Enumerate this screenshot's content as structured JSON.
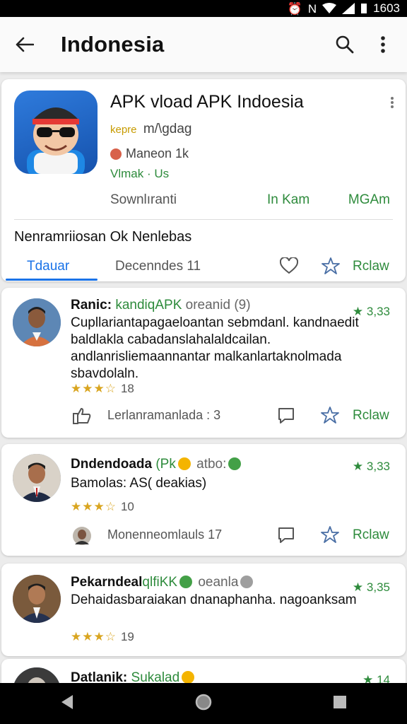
{
  "status_bar": {
    "time": "1603",
    "alarm_icon": "alarm-icon",
    "nfc_label": "N"
  },
  "app_bar": {
    "title": "Indonesia",
    "back_icon": "arrow-back-icon",
    "search_icon": "search-icon",
    "menu_icon": "more-vert-icon"
  },
  "app_card": {
    "name": "APK vload APK Indoesia",
    "badge": "kepre",
    "developer": "m/\\gdag",
    "maintainer": "Maneon 1k",
    "version": "Vlmak · Us",
    "meta": {
      "downloads": "Sownlıranti",
      "size": "In Kam",
      "rating": "MGAm"
    },
    "description": "Nenramriiosan Ok Nenlebas",
    "tab_active": "Tdauar",
    "tab_two": "Decenndes 11",
    "review_label": "Rclaw"
  },
  "reviews": [
    {
      "name": "Ranic:",
      "tag": "kandiqAPK",
      "extra": "oreanid (9)",
      "rating": "3,33",
      "rating_star": "★",
      "body": "Cupllariantapagaeloantan sebmdanl. kandnaedit baldlakla cabadanslahalaldcailan. andlanrisliemaannantar malkanlartaknolmada sbavdolaln.",
      "stars": "★★★☆",
      "star_count": "18",
      "footer_text": "Lerlanramanlada : 3",
      "review_label": "Rclaw"
    },
    {
      "name": "Dndendoada",
      "tag": "(Pk",
      "extra": "atbo:",
      "rating": "3,33",
      "rating_star": "★",
      "body": "Bamolas: AS( deakias)",
      "stars": "★★★☆",
      "star_count": "10",
      "footer_text": "Monenneomlauls 17",
      "review_label": "Rclaw"
    },
    {
      "name": "Pekarndeal",
      "tag": "qlfiKK",
      "extra": "oeanla",
      "rating": "3,35",
      "rating_star": "★",
      "body": "Dehaidasbaraiakan dnanaphanha. nagoanksam",
      "stars": "★★★☆",
      "star_count": "19"
    },
    {
      "name": "Datlanik:",
      "tag": "Sukalad",
      "rating": "14",
      "rating_star": "★"
    }
  ],
  "colors": {
    "accent_blue": "#1a73e8",
    "accent_green": "#2e8b3c",
    "star_gold": "#d9a520"
  }
}
